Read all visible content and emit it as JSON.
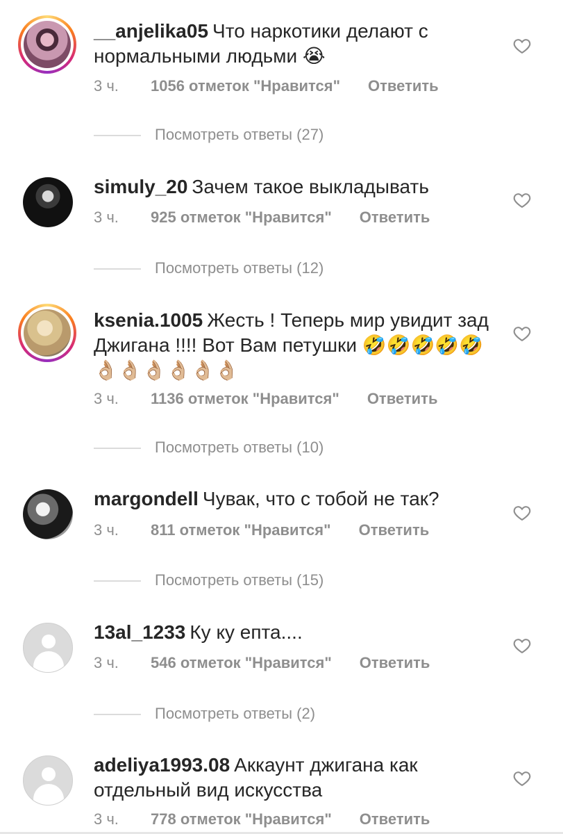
{
  "comments": [
    {
      "username": "__anjelika05",
      "text": "Что наркотики делают с нормальными людьми 😭",
      "time": "3 ч.",
      "likes": "1056 отметок \"Нравится\"",
      "reply": "Ответить",
      "view_replies": "Посмотреть ответы (27)",
      "avatar": "story-photo"
    },
    {
      "username": "simuly_20",
      "text": "Зачем такое выкладывать",
      "time": "3 ч.",
      "likes": "925 отметок \"Нравится\"",
      "reply": "Ответить",
      "view_replies": "Посмотреть ответы (12)",
      "avatar": "photo"
    },
    {
      "username": "ksenia.1005",
      "text": "Жесть ! Теперь мир увидит зад Джигана !!!! Вот Вам петушки 🤣🤣🤣🤣🤣👌🏼👌🏼👌🏼👌🏼👌🏼👌🏼",
      "time": "3 ч.",
      "likes": "1136 отметок \"Нравится\"",
      "reply": "Ответить",
      "view_replies": "Посмотреть ответы (10)",
      "avatar": "story-photo"
    },
    {
      "username": "margondell",
      "text": "Чувак, что с тобой не так?",
      "time": "3 ч.",
      "likes": "811 отметок \"Нравится\"",
      "reply": "Ответить",
      "view_replies": "Посмотреть ответы (15)",
      "avatar": "photo"
    },
    {
      "username": "13al_1233",
      "text": "Ку ку епта....",
      "time": "3 ч.",
      "likes": "546 отметок \"Нравится\"",
      "reply": "Ответить",
      "view_replies": "Посмотреть ответы (2)",
      "avatar": "placeholder"
    },
    {
      "username": "adeliya1993.08",
      "text": "Аккаунт джигана как отдельный вид искусства",
      "time": "3 ч.",
      "likes": "778 отметок \"Нравится\"",
      "reply": "Ответить",
      "avatar": "placeholder"
    }
  ],
  "icons": {
    "like": "heart-outline-icon"
  },
  "colors": {
    "text": "#262626",
    "muted": "#8e8e8e",
    "divider": "#dbdbdb"
  }
}
